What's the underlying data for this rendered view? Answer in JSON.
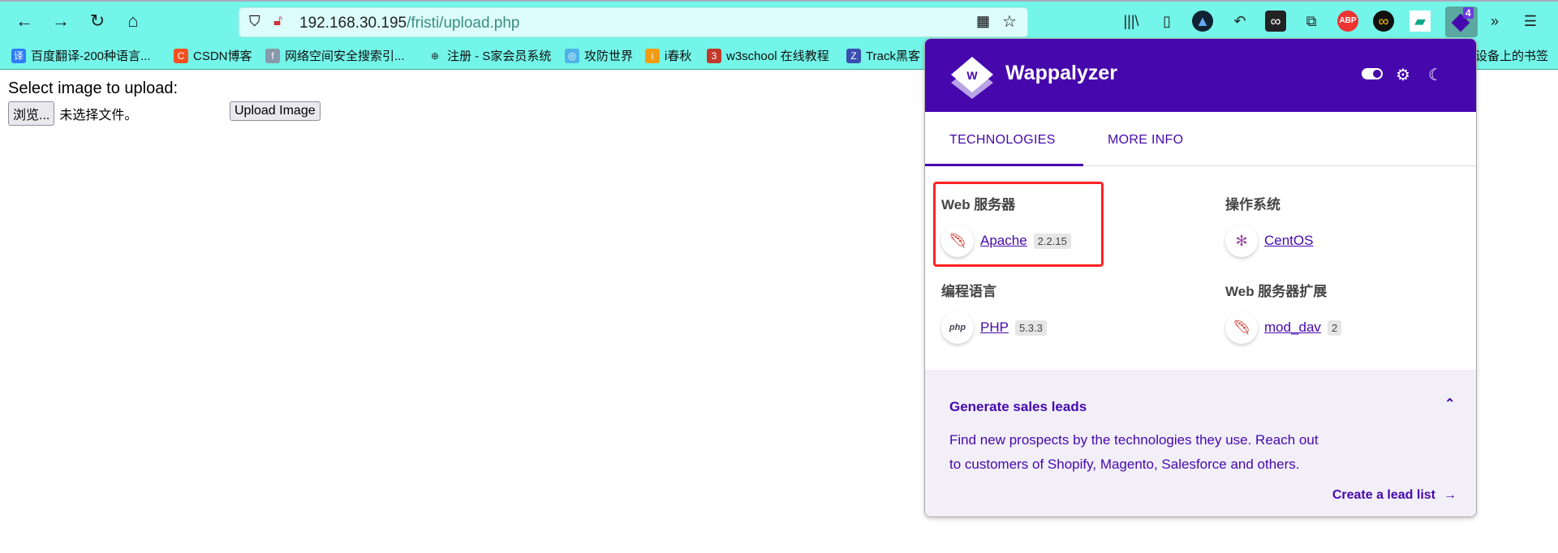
{
  "browser": {
    "url_host": "192.168.30.195",
    "url_path": "/fristi/upload.php",
    "nav_icons": [
      "back-arrow-icon",
      "forward-arrow-icon",
      "reload-icon",
      "home-icon"
    ],
    "extension_badge": "4",
    "bookmarks": [
      {
        "label": "百度翻译-200种语言...",
        "icon": "译",
        "color": "#2e7cf6"
      },
      {
        "label": "CSDN博客",
        "icon": "C",
        "color": "#f4511e"
      },
      {
        "label": "网络空间安全搜索引...",
        "icon": "f",
        "color": "#8899aa"
      },
      {
        "label": "注册 - S家会员系统",
        "icon": "⊕",
        "color": "#222222"
      },
      {
        "label": "攻防世界",
        "icon": "◎",
        "color": "#4fb3e8"
      },
      {
        "label": "i春秋",
        "icon": "i",
        "color": "#f39c12"
      },
      {
        "label": "w3school 在线教程",
        "icon": "3",
        "color": "#c0392b"
      },
      {
        "label": "Track黑客",
        "icon": "Z",
        "color": "#3a4fb0"
      }
    ],
    "bookmarks_overflow": "设备上的书签"
  },
  "page": {
    "heading": "Select image to upload:",
    "browse_button": "浏览...",
    "file_status": "未选择文件。",
    "upload_button": "Upload Image"
  },
  "wappalyzer": {
    "brand": "Wappalyzer",
    "logo_letter": "W",
    "accent": "#4608ad",
    "tabs": [
      "TECHNOLOGIES",
      "MORE INFO"
    ],
    "active_tab": "TECHNOLOGIES",
    "categories": [
      {
        "title": "Web 服务器",
        "techs": [
          {
            "name": "Apache",
            "version": "2.2.15",
            "icon": "feather-icon"
          }
        ]
      },
      {
        "title": "操作系统",
        "techs": [
          {
            "name": "CentOS",
            "version": "",
            "icon": "centos-icon"
          }
        ]
      },
      {
        "title": "编程语言",
        "techs": [
          {
            "name": "PHP",
            "version": "5.3.3",
            "icon": "php-icon"
          }
        ]
      },
      {
        "title": "Web 服务器扩展",
        "techs": [
          {
            "name": "mod_dav",
            "version": "2",
            "icon": "feather-icon"
          }
        ]
      }
    ],
    "leads": {
      "title": "Generate sales leads",
      "line1": "Find new prospects by the technologies they use. Reach out",
      "line2": "to customers of Shopify, Magento, Salesforce and others.",
      "cta": "Create a lead list"
    }
  }
}
